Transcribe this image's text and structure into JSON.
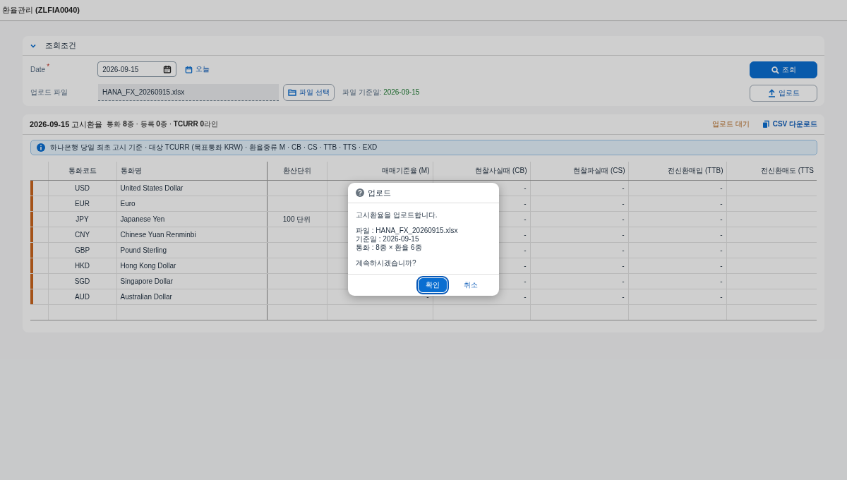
{
  "page_title": "환율관리 **(ZLFIA0040)**",
  "filter": {
    "title": "조회조건",
    "expanded": true,
    "date": {
      "label": "Date",
      "required_mark": "*",
      "value": "2026-09-15",
      "today_link": "오늘"
    },
    "file": {
      "label": "업로드 파일",
      "value": "HANA_FX_20260915.xlsx",
      "pick_button": "파일 선택",
      "date_label": "파일 기준일:",
      "date_value": "2026-09-15"
    },
    "search_button": "조회",
    "upload_button": "업로드"
  },
  "result": {
    "title": "**2026-09-15** 고시환율",
    "summary": "통화 **8**종 · 등록 **0**종 · **TCURR 0**라인",
    "status": "업로드 대기",
    "csv_link": "CSV 다운로드",
    "info": "하나은행 당일 최초 고시 기준 · 대상 TCURR (목표통화 KRW) · 환율종류 M · CB · CS · TTB · TTS · EXD",
    "columns": [
      "통화코드",
      "통화명",
      "환산단위",
      "매매기준율 (M)",
      "현찰사실때 (CB)",
      "현찰파실때 (CS)",
      "전신환매입 (TTB)",
      "전신환매도 (TTS"
    ],
    "rows": [
      {
        "pending": true,
        "cells": [
          "USD",
          "United States Dollar",
          "",
          "",
          "-",
          "-",
          "-",
          ""
        ]
      },
      {
        "pending": true,
        "cells": [
          "EUR",
          "Euro",
          "",
          "",
          "-",
          "-",
          "-",
          ""
        ]
      },
      {
        "pending": true,
        "cells": [
          "JPY",
          "Japanese Yen",
          "100 단위",
          "",
          "-",
          "-",
          "-",
          ""
        ]
      },
      {
        "pending": true,
        "cells": [
          "CNY",
          "Chinese Yuan Renminbi",
          "",
          "",
          "-",
          "-",
          "-",
          ""
        ]
      },
      {
        "pending": true,
        "cells": [
          "GBP",
          "Pound Sterling",
          "",
          "",
          "-",
          "-",
          "-",
          ""
        ]
      },
      {
        "pending": true,
        "cells": [
          "HKD",
          "Hong Kong Dollar",
          "",
          "",
          "-",
          "-",
          "-",
          ""
        ]
      },
      {
        "pending": true,
        "cells": [
          "SGD",
          "Singapore Dollar",
          "",
          "",
          "-",
          "-",
          "-",
          ""
        ]
      },
      {
        "pending": true,
        "cells": [
          "AUD",
          "Australian Dollar",
          "",
          "-",
          "-",
          "-",
          "-",
          ""
        ]
      },
      {
        "pending": false,
        "cells": [
          "",
          "",
          "",
          "",
          "",
          "",
          "",
          ""
        ]
      }
    ]
  },
  "dialog": {
    "title": "업로드",
    "paragraphs": [
      [
        "고시환율을 업로드합니다."
      ],
      [
        "파일 : HANA_FX_20260915.xlsx",
        "기준일 : 2026-09-15",
        "통화 : 8종 × 환율 6종"
      ],
      [
        "계속하시겠습니까?"
      ]
    ],
    "buttons": [
      {
        "label": "확인",
        "kind": "primary",
        "focused": true
      },
      {
        "label": "취소",
        "kind": "plain",
        "focused": false
      }
    ]
  }
}
